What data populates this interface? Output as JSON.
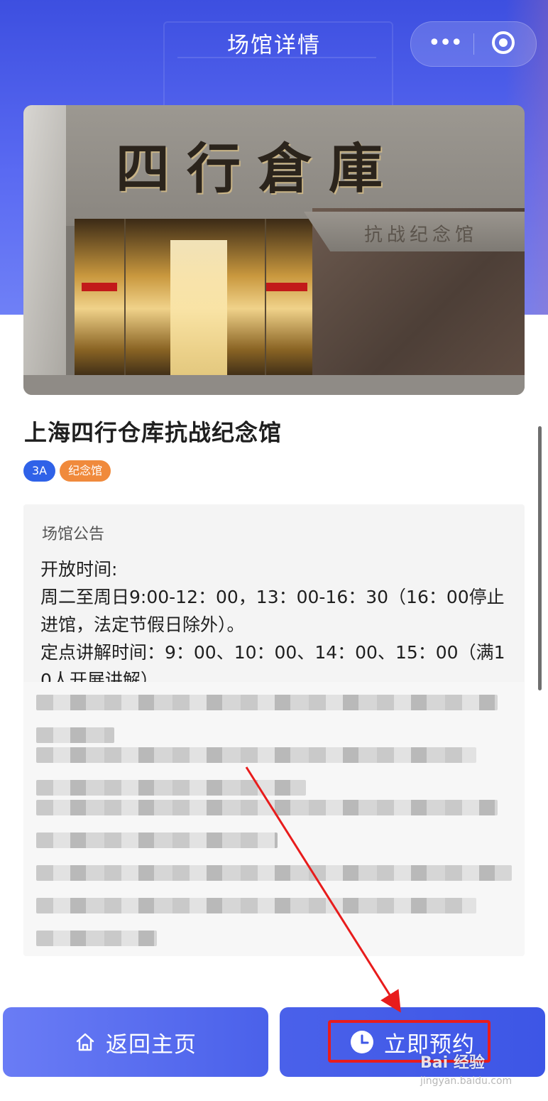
{
  "header": {
    "title": "场馆详情",
    "more_icon": "more-dots-icon",
    "close_icon": "target-circle-icon"
  },
  "hero": {
    "sign_text": "四行倉庫",
    "sub_sign_text": "抗战纪念馆"
  },
  "venue": {
    "name": "上海四行仓库抗战纪念馆",
    "tags": [
      {
        "label": "3A",
        "color": "#2f62e8"
      },
      {
        "label": "纪念馆",
        "color": "#f08a3c"
      }
    ]
  },
  "notice": {
    "title": "场馆公告",
    "body": "开放时间:\n周二至周日9:00-12：00，13：00-16：30（16：00停止进馆，法定节假日除外）。\n定点讲解时间：9：00、10：00、14：00、15：00（满10人开展讲解）。"
  },
  "actions": {
    "home_label": "返回主页",
    "home_icon": "home-icon",
    "book_label": "立即预约",
    "book_icon": "clock-icon"
  },
  "watermark": {
    "brand": "Bai 经验",
    "url": "jingyan.baidu.com"
  },
  "colors": {
    "primary": "#3d56e6",
    "header_gradient_start": "#3d4fe0",
    "tag_blue": "#2f62e8",
    "tag_orange": "#f08a3c",
    "annotation_red": "#e81c1c"
  }
}
